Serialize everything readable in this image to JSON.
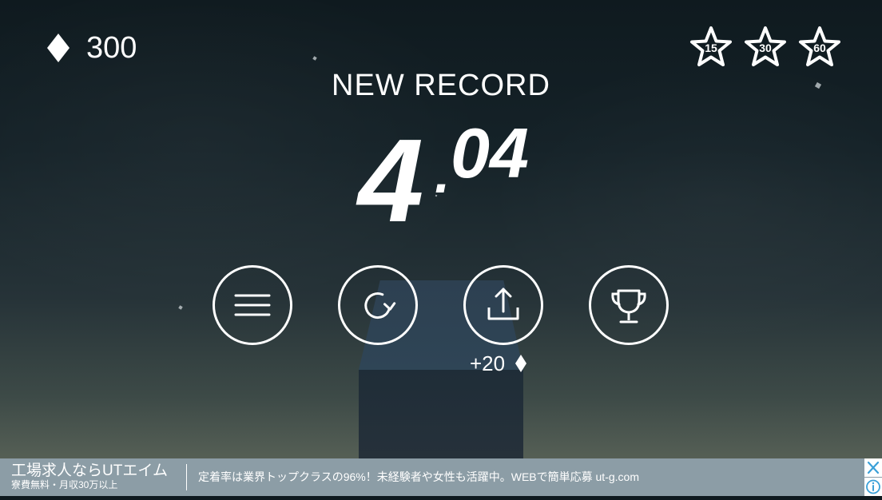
{
  "hud": {
    "gem_count": "300",
    "gem_icon": "diamond-icon"
  },
  "stars": [
    {
      "value": "15",
      "icon": "star-icon"
    },
    {
      "value": "30",
      "icon": "star-icon"
    },
    {
      "value": "60",
      "icon": "star-icon"
    }
  ],
  "result": {
    "heading": "NEW RECORD",
    "score_int": "4",
    "score_dot": ".",
    "score_dec": "04"
  },
  "actions": [
    {
      "name": "menu",
      "icon": "menu-icon"
    },
    {
      "name": "restart",
      "icon": "restart-icon"
    },
    {
      "name": "share",
      "icon": "share-icon"
    },
    {
      "name": "leaderboard",
      "icon": "trophy-icon"
    }
  ],
  "reward": {
    "text": "+20",
    "icon": "diamond-icon"
  },
  "ad": {
    "title": "工場求人ならUTエイム",
    "subtitle": "寮費無料・月収30万以上",
    "body": "定着率は業界トップクラスの96%！未経験者や女性も活躍中。WEBで簡単応募  ut-g.com",
    "close_icon": "close-icon",
    "info_icon": "info-icon"
  },
  "colors": {
    "text": "#ffffff",
    "ad_background": "#8c9da6",
    "ad_icon": "#3aa0d8",
    "cube_top": "#2f4556",
    "cube_front": "#222f3a"
  }
}
